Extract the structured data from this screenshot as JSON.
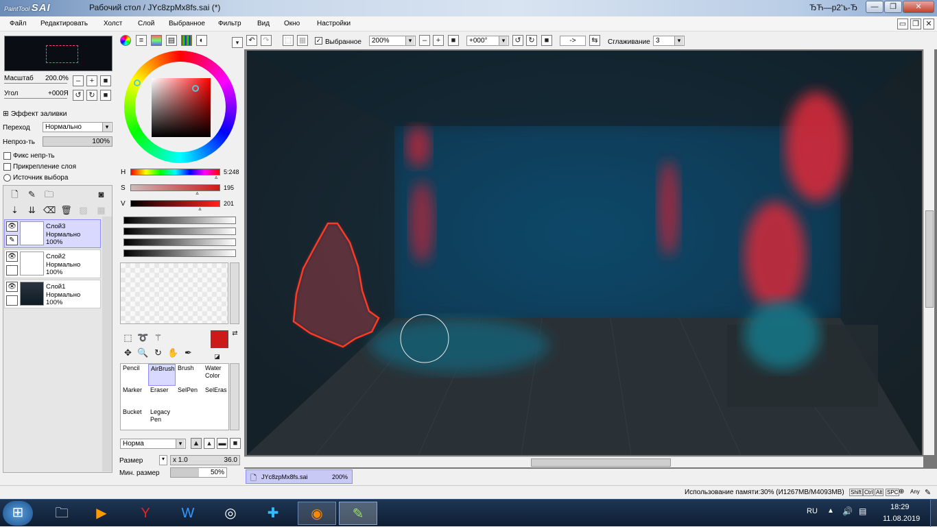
{
  "app": {
    "logo_small": "PaintTool",
    "logo_big": "SAI",
    "title": "Рабочий стол / JYc8zpMx8fs.sai (*)",
    "lang_indicator": "ЂЋ—р2'ъ-Ђ"
  },
  "window_buttons": {
    "minimize": "—",
    "maximize": "❐",
    "close": "✕"
  },
  "menu": [
    "Файл",
    "Редактировать",
    "Холст",
    "Слой",
    "Выбранное",
    "Фильтр",
    "Вид",
    "Окно",
    "Настройки"
  ],
  "navigator": {
    "zoom_label": "Масштаб",
    "zoom_value": "200.0%",
    "angle_label": "Угол",
    "angle_value": "+000Я"
  },
  "layer_props": {
    "fill_effect": "Эффект заливки",
    "blend_label": "Переход",
    "blend_value": "Нормально",
    "opacity_label": "Непроз-ть",
    "opacity_value": "100%",
    "opacity_level": 1.0,
    "fix_opacity": "Фикс непр-ть",
    "clip_layer": "Прикрепление слоя",
    "selection_source": "Источник выбора"
  },
  "layers": [
    {
      "name": "Слой3",
      "mode": "Нормально",
      "opacity": "100%",
      "selected": true
    },
    {
      "name": "Слой2",
      "mode": "Нормально",
      "opacity": "100%",
      "selected": false
    },
    {
      "name": "Слой1",
      "mode": "Нормально",
      "opacity": "100%",
      "selected": false
    }
  ],
  "color": {
    "h_label": "H",
    "h_value": "5:248",
    "s_label": "S",
    "s_value": "195",
    "v_label": "V",
    "v_value": "201",
    "h_level": 0.97,
    "s_level": 0.76,
    "v_level": 0.79,
    "current_color": "#cc1a1a",
    "secondary_color": "#ffffff"
  },
  "tools": [
    {
      "label": "Pencil",
      "selected": false
    },
    {
      "label": "AirBrush",
      "selected": true
    },
    {
      "label": "Brush",
      "selected": false
    },
    {
      "label": "Water Color",
      "selected": false
    },
    {
      "label": "Marker",
      "selected": false
    },
    {
      "label": "Eraser",
      "selected": false
    },
    {
      "label": "SelPen",
      "selected": false
    },
    {
      "label": "SelEras",
      "selected": false
    },
    {
      "label": "Bucket",
      "selected": false
    },
    {
      "label": "Legacy Pen",
      "selected": false
    }
  ],
  "brush": {
    "mode": "Норма",
    "size_label": "Размер",
    "size_mult": "x 1.0",
    "size_value": "36.0",
    "min_size_label": "Мин. размер",
    "min_size_value": "50%",
    "min_size_level": 0.5
  },
  "canvas_toolbar": {
    "selection_label": "Выбранное",
    "zoom": "200%",
    "angle": "+000°",
    "flip": "->",
    "smoothing_label": "Сглаживание",
    "smoothing_value": "3"
  },
  "document_tab": {
    "name": "JYc8zpMx8fs.sai",
    "zoom": "200%"
  },
  "status": {
    "memory": "Использование памяти:30% (И1267MB/M4093MB)",
    "keys": [
      "Shift",
      "Ctrl",
      "Alt",
      "SPC",
      "Any"
    ]
  },
  "taskbar": {
    "lang": "RU",
    "time": "18:29",
    "date": "11.08.2019"
  }
}
